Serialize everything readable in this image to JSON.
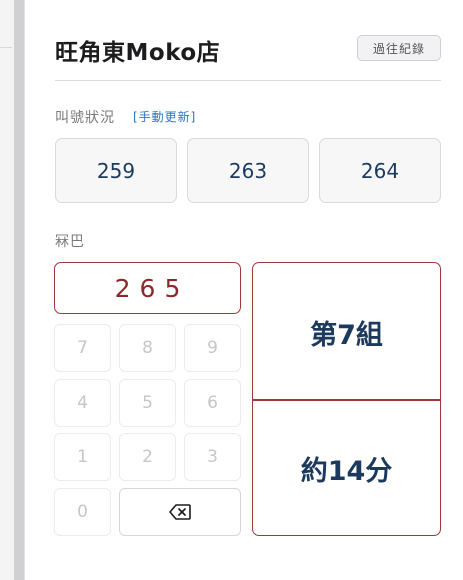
{
  "store": {
    "name": "旺角東Moko店"
  },
  "history_button": {
    "label": "過往紀錄"
  },
  "call_status": {
    "label": "叫號狀況",
    "refresh_link": "[手動更新]",
    "numbers": [
      "259",
      "263",
      "264"
    ]
  },
  "ticket": {
    "label": "冧巴",
    "entered_number": "265"
  },
  "keypad": {
    "keys": [
      "7",
      "8",
      "9",
      "4",
      "5",
      "6",
      "1",
      "2",
      "3",
      "0"
    ],
    "backspace_icon": "backspace-icon"
  },
  "result": {
    "position": "第7組",
    "wait_time": "約14分"
  },
  "colors": {
    "accent_red": "#9c3a3a",
    "number_blue": "#1c3a5e",
    "link_blue": "#2b72c9"
  }
}
